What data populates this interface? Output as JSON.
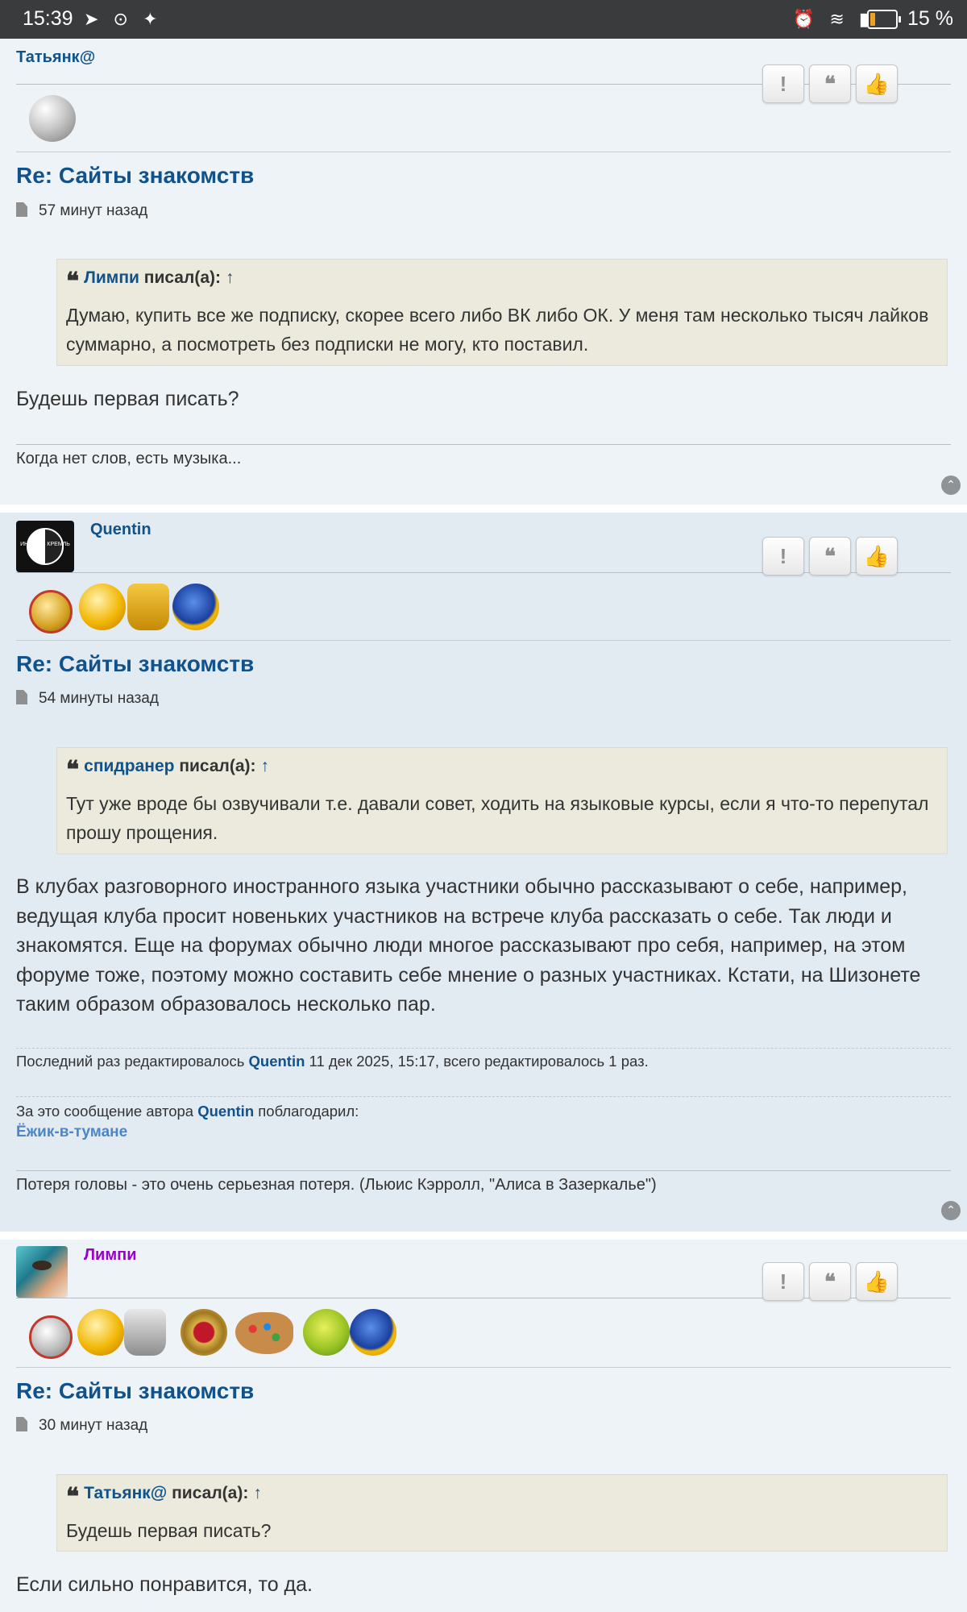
{
  "status_bar": {
    "time": "15:39",
    "left_icons": "➤ ⊙ ✦",
    "right_icons": "⏰ ≋ ▮",
    "battery": "15 %"
  },
  "buttons": {
    "report": "!",
    "quote": "❝",
    "like": "👍"
  },
  "posts": [
    {
      "author": "Татьянк@",
      "title": "Re: Сайты знакомств",
      "time": "57 минут назад",
      "quote_author": "Лимпи",
      "quote_label": "писал(а):",
      "quote_arrow": "↑",
      "quote_text": "Думаю, купить все же подписку, скорее всего либо ВК либо ОК. У меня там несколько тысяч лайков суммарно, а посмотреть без подписки не могу, кто поставил.",
      "body": "Будешь первая писать?",
      "signature": "Когда нет слов, есть музыка..."
    },
    {
      "author": "Quentin",
      "title": "Re: Сайты знакомств",
      "time": "54 минуты назад",
      "quote_author": "спидранер",
      "quote_label": "писал(а):",
      "quote_arrow": "↑",
      "quote_text": "Тут уже вроде бы озвучивали т.е. давали совет, ходить на языковые курсы, если я что-то перепутал прошу прощения.",
      "body": "В клубах разговорного иностранного языка участники обычно рассказывают о себе, например, ведущая клуба просит новеньких участников на встрече клуба рассказать о себе. Так люди и знакомятся. Еще на форумах обычно люди многое рассказывают про себя, например, на этом форуме тоже, поэтому можно составить себе мнение о разных участниках. Кстати, на Шизонете таким образом образовалось несколько пар.",
      "edit_prefix": "Последний раз редактировалось",
      "edit_user": "Quentin",
      "edit_suffix": "11 дек 2025, 15:17, всего редактировалось 1 раз.",
      "thanks_prefix": "За это сообщение автора",
      "thanks_user": "Quentin",
      "thanks_suffix": "поблагодарил:",
      "thanks_by": "Ёжик-в-тумане",
      "signature": "Потеря головы - это очень серьезная потеря. (Льюис Кэрролл, \"Алиса в Зазеркалье\")"
    },
    {
      "author": "Лимпи",
      "title": "Re: Сайты знакомств",
      "time": "30 минут назад",
      "quote_author": "Татьянк@",
      "quote_label": "писал(а):",
      "quote_arrow": "↑",
      "quote_text": "Будешь первая писать?",
      "body": "Если сильно понравится, то да."
    }
  ],
  "avatar2_text": "ИНЬ ЯНЬ КРЕМЛЬ",
  "colors": {
    "link": "#105289",
    "post_bg_1": "#eef3f7",
    "post_bg_2": "#e2eaf2",
    "quote_bg": "#ebeadd",
    "author3": "#9900cc"
  }
}
